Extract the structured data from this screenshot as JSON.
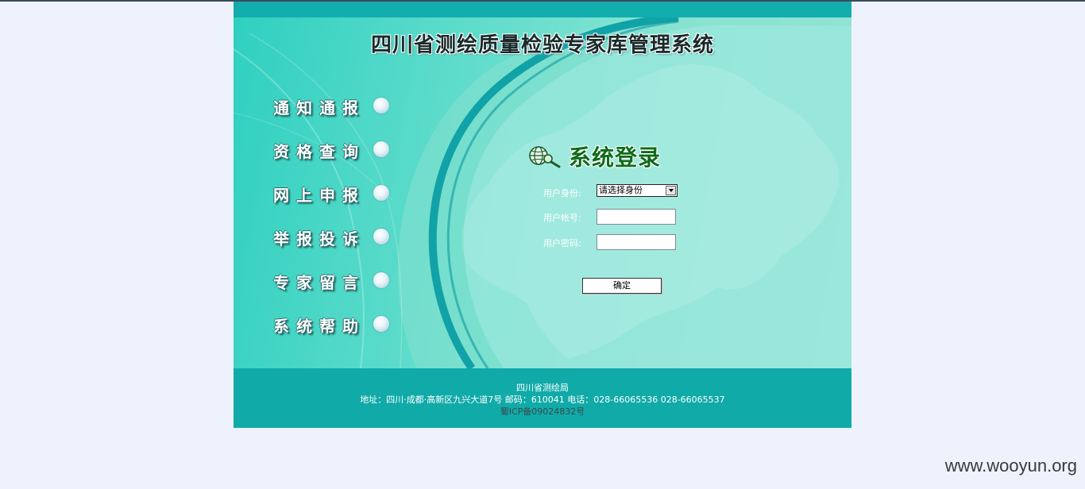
{
  "header": {
    "title": "四川省测绘质量检验专家库管理系统"
  },
  "nav": {
    "items": [
      {
        "label": "通知通报"
      },
      {
        "label": "资格查询"
      },
      {
        "label": "网上申报"
      },
      {
        "label": "举报投诉"
      },
      {
        "label": "专家留言"
      },
      {
        "label": "系统帮助"
      }
    ]
  },
  "login": {
    "title": "系统登录",
    "role_label": "用户身份:",
    "role_value": "请选择身份",
    "account_label": "用户帐号:",
    "account_value": "",
    "password_label": "用户密码:",
    "password_value": "",
    "submit_label": "确定"
  },
  "footer": {
    "org": "四川省测绘局",
    "address": "地址：四川·成都·高新区九兴大道7号 邮码：610041 电话：028-66065536 028-66065537",
    "icp": "蜀ICP备09024832号"
  },
  "watermark": "www.wooyun.org",
  "colors": {
    "teal": "#12aeae",
    "background": "#edf2fd",
    "title_green": "#0e6a1a"
  }
}
